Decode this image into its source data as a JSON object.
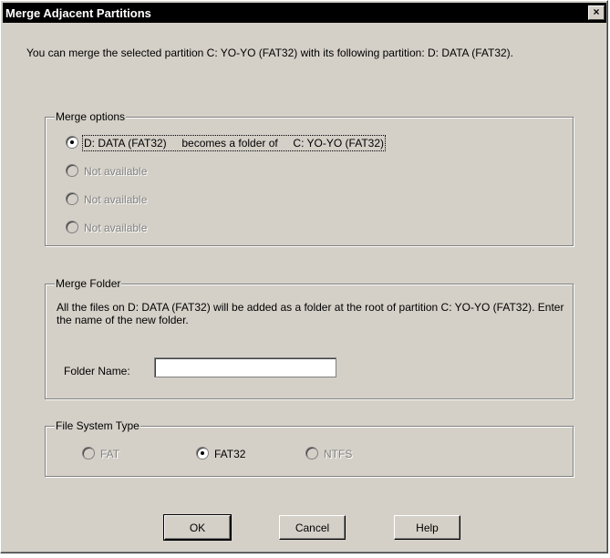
{
  "window": {
    "title": "Merge Adjacent Partitions",
    "close_label": "×"
  },
  "intro": {
    "text": "You can merge the selected partition  C: YO-YO (FAT32)  with its following partition:  D: DATA (FAT32)."
  },
  "merge_options": {
    "label": "Merge options",
    "options": [
      {
        "label": "D: DATA (FAT32)     becomes a folder of     C: YO-YO (FAT32)",
        "selected": true,
        "enabled": true
      },
      {
        "label": "Not available",
        "selected": false,
        "enabled": false
      },
      {
        "label": "Not available",
        "selected": false,
        "enabled": false
      },
      {
        "label": "Not available",
        "selected": false,
        "enabled": false
      }
    ]
  },
  "merge_folder": {
    "label": "Merge Folder",
    "description": "All the files on  D: DATA (FAT32)  will be added as a folder at the root of partition  C: YO-YO (FAT32).  Enter the name of the new folder.",
    "folder_name_label": "Folder Name:",
    "folder_name_value": ""
  },
  "file_system_type": {
    "label": "File System Type",
    "options": [
      {
        "label": "FAT",
        "selected": false,
        "enabled": false
      },
      {
        "label": "FAT32",
        "selected": true,
        "enabled": true
      },
      {
        "label": "NTFS",
        "selected": false,
        "enabled": false
      }
    ]
  },
  "buttons": {
    "ok": "OK",
    "cancel": "Cancel",
    "help": "Help"
  }
}
